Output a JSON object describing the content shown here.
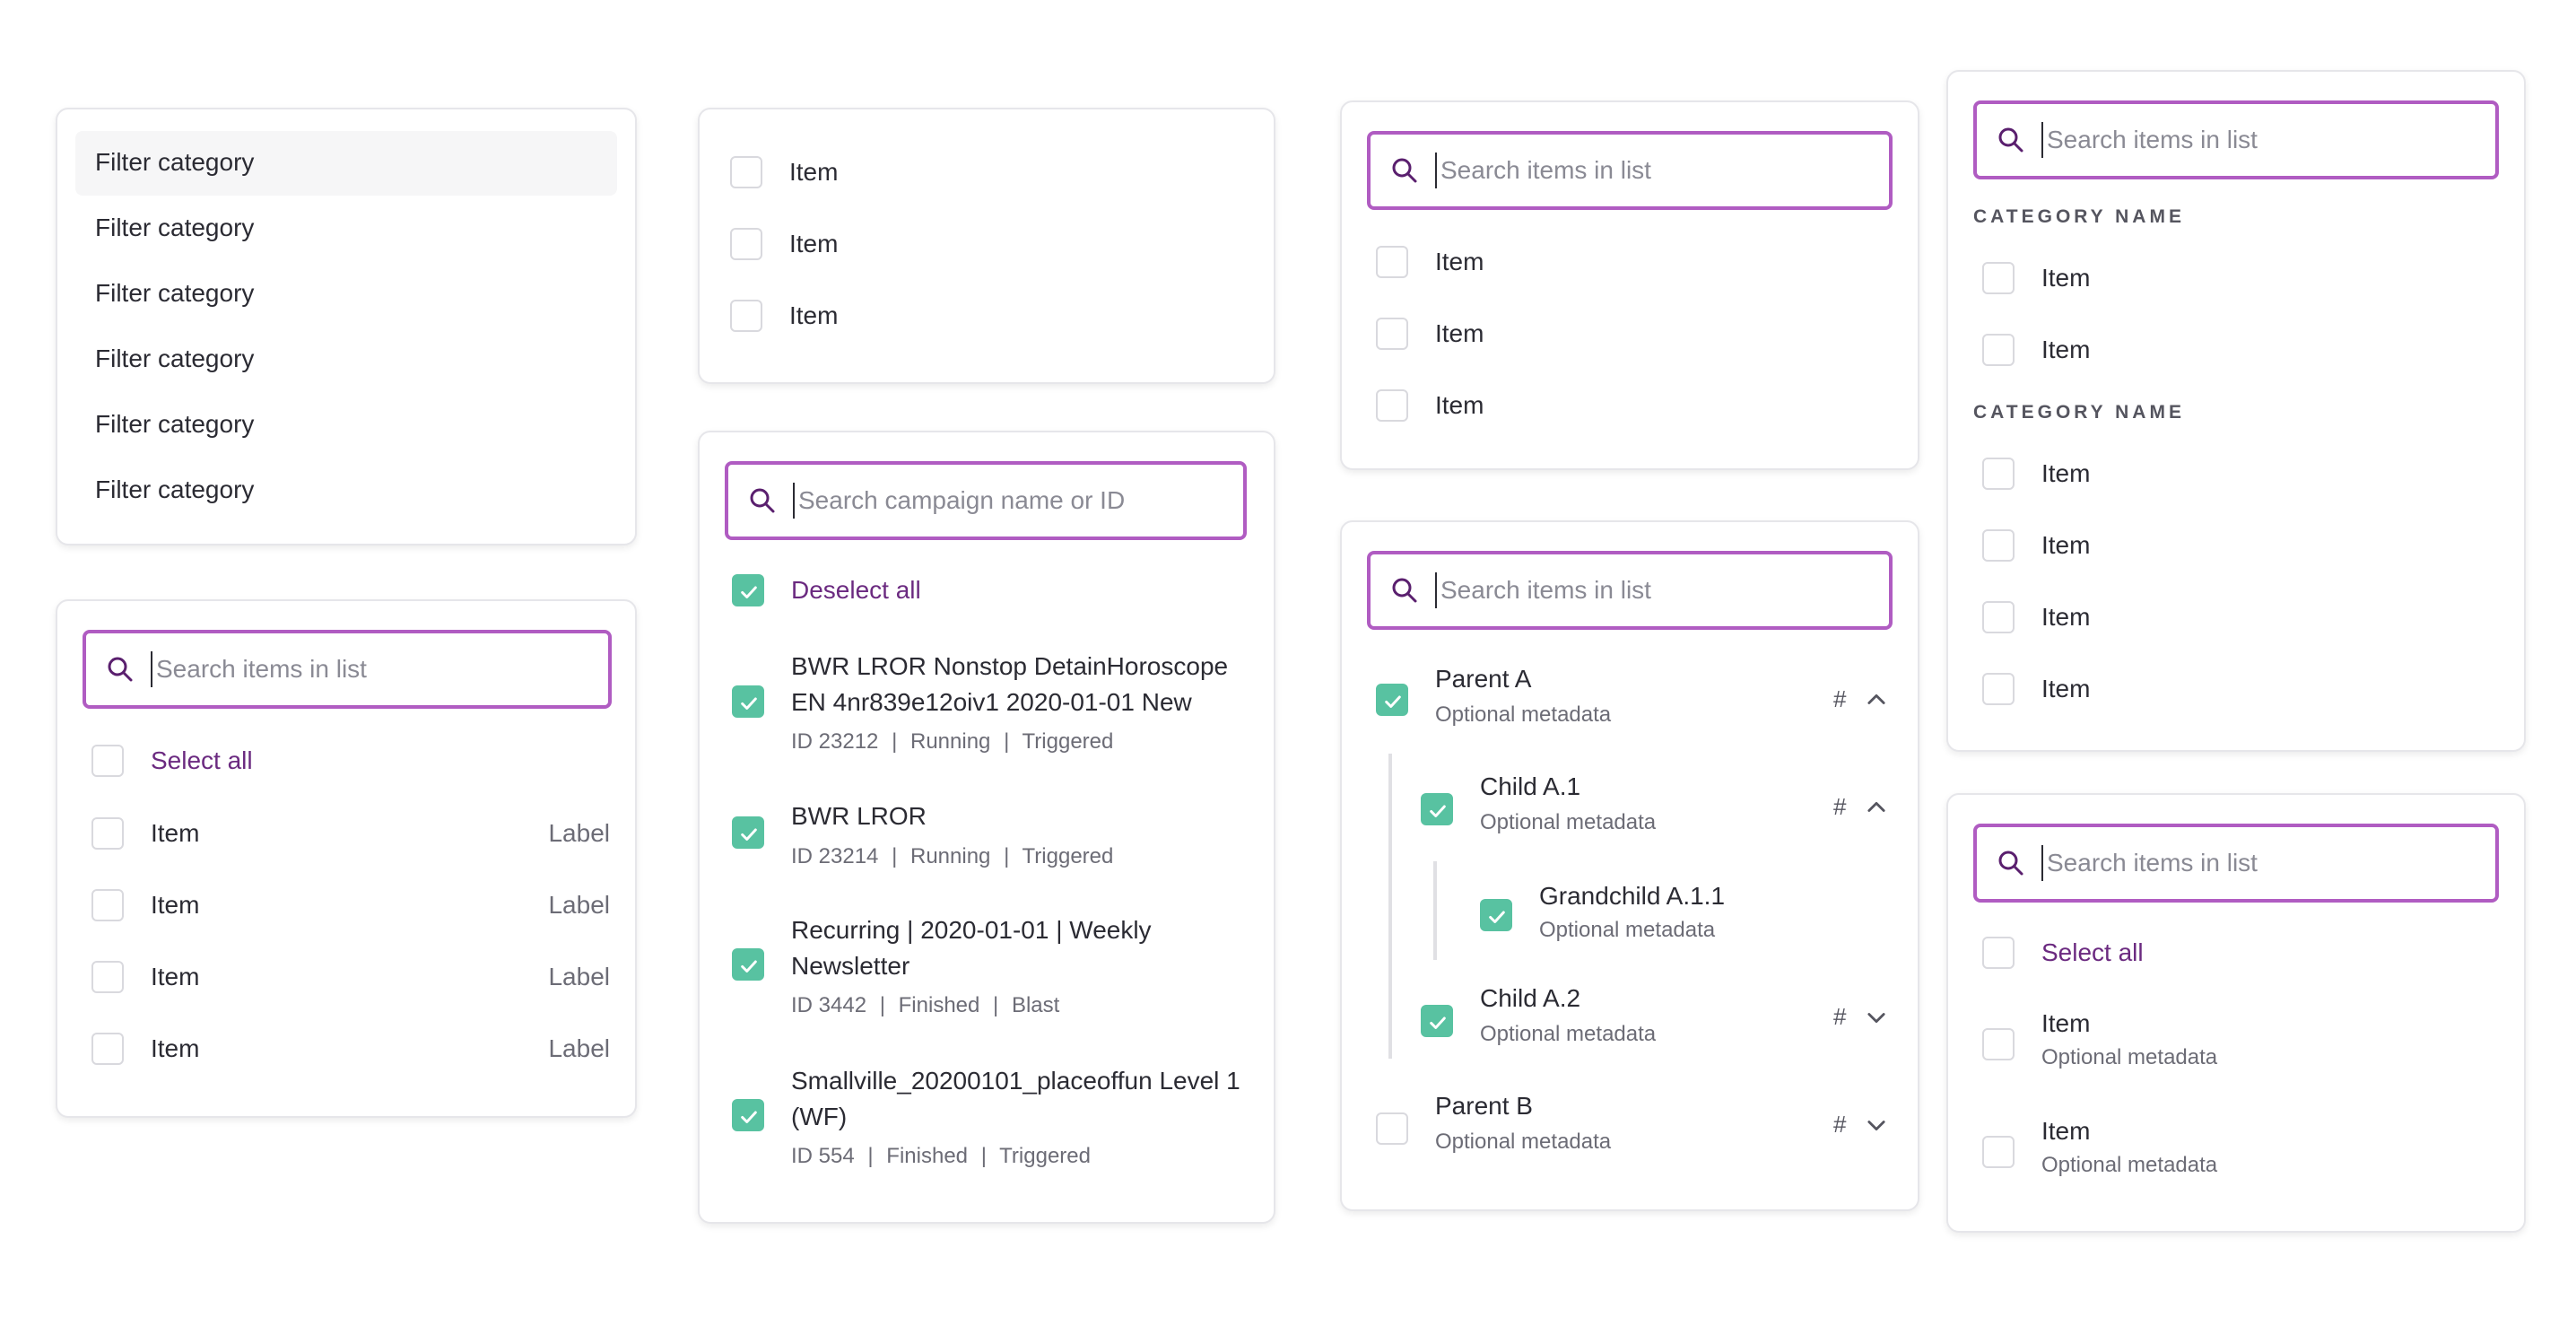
{
  "colors": {
    "accent": "#b05cc2",
    "checked": "#58c2a1",
    "link": "#6b2a80"
  },
  "filter_panel": {
    "items": [
      "Filter category",
      "Filter category",
      "Filter category",
      "Filter category",
      "Filter category",
      "Filter category"
    ]
  },
  "simple_list": {
    "items": [
      "Item",
      "Item",
      "Item"
    ]
  },
  "label_list": {
    "search_placeholder": "Search items in list",
    "select_all": "Select all",
    "items": [
      {
        "label": "Item",
        "tag": "Label"
      },
      {
        "label": "Item",
        "tag": "Label"
      },
      {
        "label": "Item",
        "tag": "Label"
      },
      {
        "label": "Item",
        "tag": "Label"
      }
    ]
  },
  "campaign_list": {
    "search_placeholder": "Search campaign name or ID",
    "deselect_all": "Deselect all",
    "items": [
      {
        "title1": "BWR LROR Nonstop DetainHoroscope",
        "title2": "EN 4nr839e12oiv1 2020-01-01 New",
        "id": "ID 23212",
        "status": "Running",
        "type": "Triggered"
      },
      {
        "title1": "BWR LROR",
        "title2": "",
        "id": "ID 23214",
        "status": "Running",
        "type": "Triggered"
      },
      {
        "title1": "Recurring | 2020-01-01 | Weekly",
        "title2": "Newsletter",
        "id": "ID 3442",
        "status": "Finished",
        "type": "Blast"
      },
      {
        "title1": "Smallville_20200101_placeoffun Level 1",
        "title2": "(WF)",
        "id": "ID 554",
        "status": "Finished",
        "type": "Triggered"
      }
    ],
    "separator": "|"
  },
  "search_list": {
    "search_placeholder": "Search items in list",
    "items": [
      "Item",
      "Item",
      "Item"
    ]
  },
  "tree_list": {
    "search_placeholder": "Search items in list",
    "hash": "#",
    "nodes": [
      {
        "label": "Parent A",
        "meta": "Optional metadata",
        "checked": true,
        "expanded": true
      },
      {
        "label": "Child A.1",
        "meta": "Optional metadata",
        "checked": true,
        "expanded": true
      },
      {
        "label": "Grandchild A.1.1",
        "meta": "Optional metadata",
        "checked": true
      },
      {
        "label": "Child A.2",
        "meta": "Optional metadata",
        "checked": true,
        "expanded": false
      },
      {
        "label": "Parent B",
        "meta": "Optional metadata",
        "checked": false,
        "expanded": false
      }
    ]
  },
  "category_list": {
    "search_placeholder": "Search items in list",
    "cat1": "CATEGORY NAME",
    "cat1_items": [
      "Item",
      "Item"
    ],
    "cat2": "CATEGORY NAME",
    "cat2_items": [
      "Item",
      "Item",
      "Item",
      "Item"
    ]
  },
  "meta_list": {
    "search_placeholder": "Search items in list",
    "select_all": "Select all",
    "items": [
      {
        "label": "Item",
        "meta": "Optional metadata"
      },
      {
        "label": "Item",
        "meta": "Optional metadata"
      }
    ]
  }
}
